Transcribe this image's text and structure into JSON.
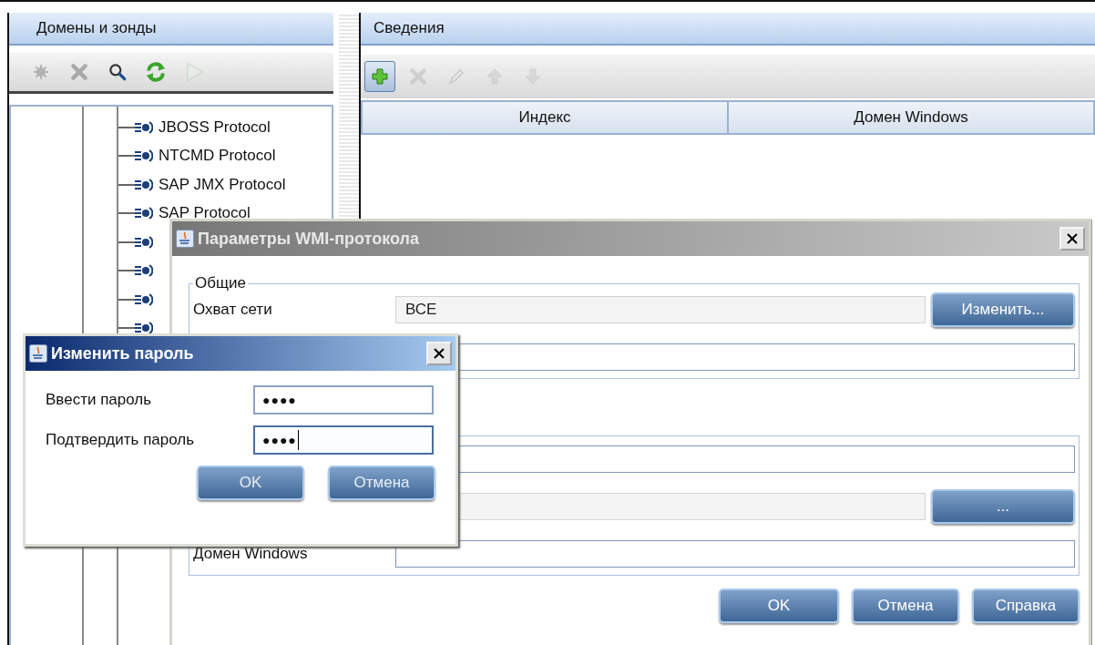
{
  "left_panel": {
    "title": "Домены и зонды",
    "toolbar": [
      {
        "kind": "gear",
        "disabled": true
      },
      {
        "kind": "delete",
        "disabled": true
      },
      {
        "kind": "search",
        "disabled": false
      },
      {
        "kind": "refresh",
        "disabled": false
      },
      {
        "kind": "play",
        "disabled": true
      }
    ],
    "tree": [
      {
        "kind": "protocol",
        "label": "JBOSS Protocol"
      },
      {
        "kind": "protocol",
        "label": "NTCMD Protocol"
      },
      {
        "kind": "protocol",
        "label": "SAP JMX Protocol"
      },
      {
        "kind": "protocol",
        "label": "SAP Protocol"
      },
      {
        "kind": "protocol"
      },
      {
        "kind": "protocol"
      },
      {
        "kind": "protocol"
      },
      {
        "kind": "protocol"
      }
    ]
  },
  "right_panel": {
    "title": "Сведения",
    "toolbar": [
      {
        "kind": "add",
        "disabled": false
      },
      {
        "kind": "delete",
        "disabled": true
      },
      {
        "kind": "edit",
        "disabled": true
      },
      {
        "kind": "up",
        "disabled": true
      },
      {
        "kind": "down",
        "disabled": true
      }
    ],
    "table": {
      "columns": [
        "Индекс",
        "Домен Windows"
      ]
    }
  },
  "wmi_dialog": {
    "title": "Параметры WMI-протокола",
    "active": false,
    "group_1": {
      "title": "Общие",
      "rows": [
        {
          "label": "Охват сети",
          "value": "ВСЕ",
          "readonly": true,
          "button": "Изменить..."
        },
        {
          "readonly": false
        }
      ]
    },
    "group_2": {
      "rows": [
        {
          "readonly": false
        },
        {
          "readonly": true,
          "button": "..."
        },
        {
          "label": "Домен Windows",
          "readonly": false
        }
      ]
    },
    "buttons": [
      "OK",
      "Отмена",
      "Справка"
    ]
  },
  "password_dialog": {
    "title": "Изменить пароль",
    "active": true,
    "fields": [
      {
        "label": "Ввести пароль",
        "value": "●●●●",
        "focused": false
      },
      {
        "label": "Подтвердить пароль",
        "value": "●●●●",
        "focused": true
      }
    ],
    "buttons": [
      "OK",
      "Отмена"
    ]
  }
}
